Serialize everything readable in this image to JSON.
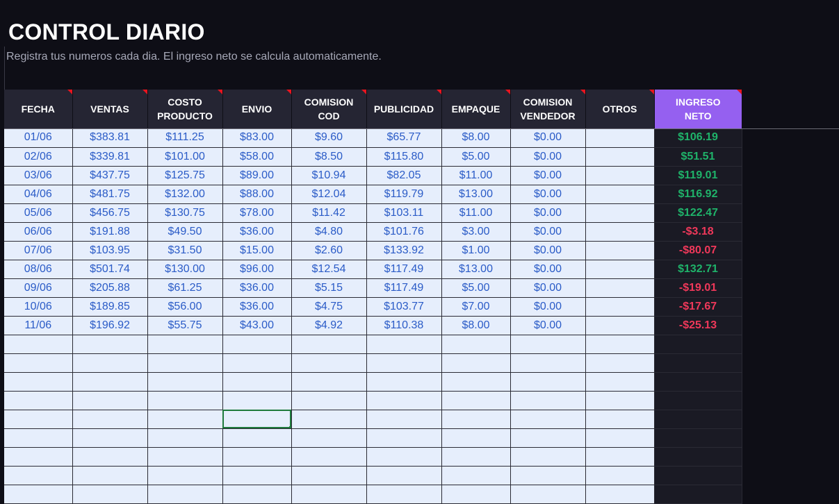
{
  "header": {
    "title": "CONTROL DIARIO",
    "subtitle": "Registra tus numeros cada dia. El ingreso neto se calcula automaticamente."
  },
  "columns": [
    {
      "line1": "FECHA",
      "line2": ""
    },
    {
      "line1": "VENTAS",
      "line2": ""
    },
    {
      "line1": "COSTO",
      "line2": "PRODUCTO"
    },
    {
      "line1": "ENVIO",
      "line2": ""
    },
    {
      "line1": "COMISION",
      "line2": "COD"
    },
    {
      "line1": "PUBLICIDAD",
      "line2": ""
    },
    {
      "line1": "EMPAQUE",
      "line2": ""
    },
    {
      "line1": "COMISION",
      "line2": "VENDEDOR"
    },
    {
      "line1": "OTROS",
      "line2": ""
    },
    {
      "line1": "INGRESO",
      "line2": "NETO"
    }
  ],
  "rows": [
    [
      "01/06",
      "$383.81",
      "$111.25",
      "$83.00",
      "$9.60",
      "$65.77",
      "$8.00",
      "$0.00",
      "",
      "$106.19"
    ],
    [
      "02/06",
      "$339.81",
      "$101.00",
      "$58.00",
      "$8.50",
      "$115.80",
      "$5.00",
      "$0.00",
      "",
      "$51.51"
    ],
    [
      "03/06",
      "$437.75",
      "$125.75",
      "$89.00",
      "$10.94",
      "$82.05",
      "$11.00",
      "$0.00",
      "",
      "$119.01"
    ],
    [
      "04/06",
      "$481.75",
      "$132.00",
      "$88.00",
      "$12.04",
      "$119.79",
      "$13.00",
      "$0.00",
      "",
      "$116.92"
    ],
    [
      "05/06",
      "$456.75",
      "$130.75",
      "$78.00",
      "$11.42",
      "$103.11",
      "$11.00",
      "$0.00",
      "",
      "$122.47"
    ],
    [
      "06/06",
      "$191.88",
      "$49.50",
      "$36.00",
      "$4.80",
      "$101.76",
      "$3.00",
      "$0.00",
      "",
      "-$3.18"
    ],
    [
      "07/06",
      "$103.95",
      "$31.50",
      "$15.00",
      "$2.60",
      "$133.92",
      "$1.00",
      "$0.00",
      "",
      "-$80.07"
    ],
    [
      "08/06",
      "$501.74",
      "$130.00",
      "$96.00",
      "$12.54",
      "$117.49",
      "$13.00",
      "$0.00",
      "",
      "$132.71"
    ],
    [
      "09/06",
      "$205.88",
      "$61.25",
      "$36.00",
      "$5.15",
      "$117.49",
      "$5.00",
      "$0.00",
      "",
      "-$19.01"
    ],
    [
      "10/06",
      "$189.85",
      "$56.00",
      "$36.00",
      "$4.75",
      "$103.77",
      "$7.00",
      "$0.00",
      "",
      "-$17.67"
    ],
    [
      "11/06",
      "$196.92",
      "$55.75",
      "$43.00",
      "$4.92",
      "$110.38",
      "$8.00",
      "$0.00",
      "",
      "-$25.13"
    ]
  ],
  "colors": {
    "positive": "#1fb36a",
    "negative": "#f0385a",
    "header_accent": "#9560f0",
    "cell_text": "#2a5bc7",
    "cell_bg": "#e6eefc"
  }
}
